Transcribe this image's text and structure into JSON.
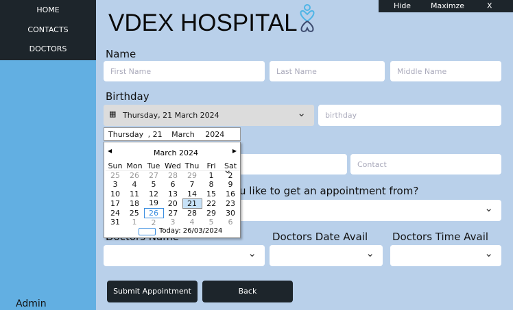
{
  "sidebar": {
    "items": [
      {
        "label": "HOME"
      },
      {
        "label": "CONTACTS"
      },
      {
        "label": "DOCTORS"
      }
    ],
    "user": "Admin"
  },
  "window": {
    "hide": "Hide",
    "maximize": "Maximze",
    "close": "X"
  },
  "header": {
    "title": "VDEX HOSPITAL",
    "logo": "heart-person-logo-icon"
  },
  "form": {
    "name_label": "Name",
    "first_name": "First Name",
    "last_name": "Last Name",
    "middle_name": "Middle Name",
    "birthday_label": "Birthday",
    "birthday_value": "Thursday, 21 March 2024",
    "birthday_placeholder": "birthday",
    "contact_placeholder": "Contact",
    "appointment_label_partial": "u like to get an appointment from?",
    "doctors_name_label": "Doctors Name",
    "doctors_date_label": "Doctors Date Avail",
    "doctors_time_label": "Doctors Time Avail",
    "submit": "Submit Appointment",
    "back": "Back"
  },
  "datepicker": {
    "edit": {
      "weekday": "Thursday",
      "sep": ",",
      "day": "21",
      "month": "March",
      "year": "2024"
    },
    "month_title": "March 2024",
    "weekdays": [
      "Sun",
      "Mon",
      "Tue",
      "Wed",
      "Thu",
      "Fri",
      "Sat"
    ],
    "weeks": [
      [
        25,
        26,
        27,
        28,
        29,
        1,
        2
      ],
      [
        3,
        4,
        5,
        6,
        7,
        8,
        9
      ],
      [
        10,
        11,
        12,
        13,
        14,
        15,
        16
      ],
      [
        17,
        18,
        19,
        20,
        21,
        22,
        23
      ],
      [
        24,
        25,
        26,
        27,
        28,
        29,
        30
      ],
      [
        31,
        1,
        2,
        3,
        4,
        5,
        6
      ]
    ],
    "selected": 21,
    "today_day": 26,
    "today_label": "Today: 26/03/2024"
  }
}
